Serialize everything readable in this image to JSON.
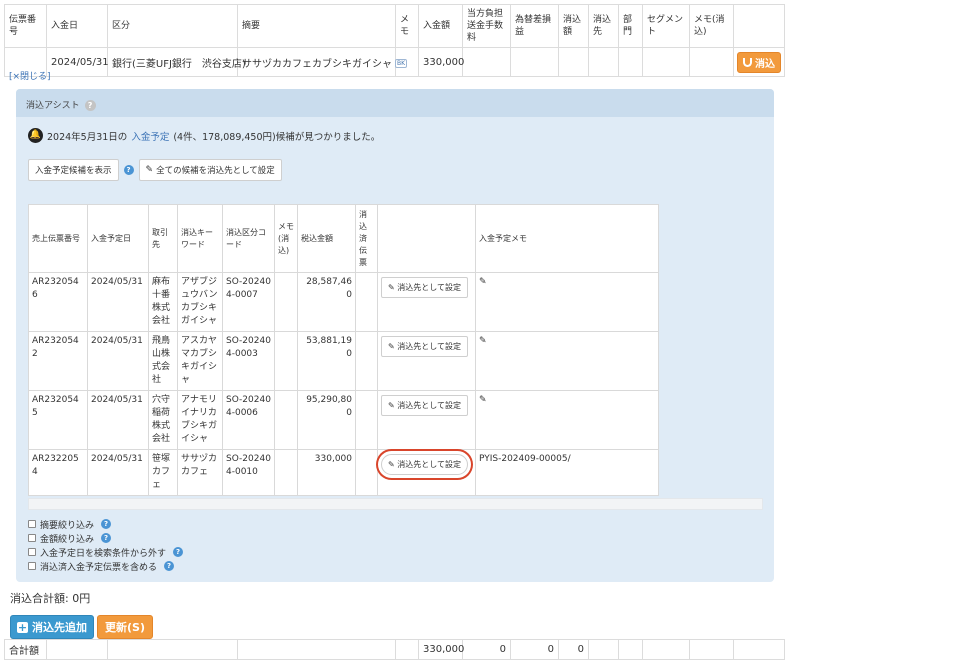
{
  "top_table": {
    "headers": [
      "伝票番号",
      "入金日",
      "区分",
      "摘要",
      "メモ",
      "入金額",
      "当方負担 送金手数料",
      "為替差損益",
      "消込額",
      "消込先",
      "部門",
      "セグメント",
      "メモ(消込)",
      ""
    ],
    "row": {
      "slip_no": "",
      "date": "2024/05/31",
      "category": "銀行(三菱UFJ銀行　渋谷支店)",
      "summary": "ササヅカカフェカブシキガイシャ",
      "bk_badge": "BK",
      "memo": "",
      "amount": "330,000",
      "reconcile_button": "消込"
    }
  },
  "close_link": "[×閉じる]",
  "assist": {
    "title": "消込アシスト",
    "notice_prefix": "2024年5月31日の",
    "notice_link": "入金予定",
    "notice_suffix": "(4件、178,089,450円)候補が見つかりました。",
    "show_candidates_button": "入金予定候補を表示",
    "set_all_button": "全ての候補を消込先として設定",
    "table": {
      "headers": [
        "売上伝票番号",
        "入金予定日",
        "取引先",
        "消込キーワード",
        "消込区分コード",
        "メモ(消込)",
        "税込金額",
        "消込済伝票",
        "",
        "入金予定メモ"
      ],
      "rows": [
        {
          "no": "AR2320546",
          "date": "2024/05/31",
          "partner": "麻布十番株式会社",
          "keyword": "アザブジュウバンカブシキガイシャ",
          "code": "SO-202404-0007",
          "memo": "",
          "amount": "28,587,460",
          "done": "",
          "button": "消込先として設定",
          "note": ""
        },
        {
          "no": "AR2320542",
          "date": "2024/05/31",
          "partner": "飛鳥山株式会社",
          "keyword": "アスカヤマカブシキガイシャ",
          "code": "SO-202404-0003",
          "memo": "",
          "amount": "53,881,190",
          "done": "",
          "button": "消込先として設定",
          "note": ""
        },
        {
          "no": "AR2320545",
          "date": "2024/05/31",
          "partner": "穴守稲荷株式会社",
          "keyword": "アナモリイナリカブシキガイシャ",
          "code": "SO-202404-0006",
          "memo": "",
          "amount": "95,290,800",
          "done": "",
          "button": "消込先として設定",
          "note": ""
        },
        {
          "no": "AR2322054",
          "date": "2024/05/31",
          "partner": "笹塚カフェ",
          "keyword": "ササヅカカフェ",
          "code": "SO-202404-0010",
          "memo": "",
          "amount": "330,000",
          "done": "",
          "button": "消込先として設定",
          "note": "PYIS-202409-00005/"
        }
      ]
    },
    "checkboxes": [
      "摘要絞り込み",
      "金額絞り込み",
      "入金予定日を検索条件から外す",
      "消込済入金予定伝票を含める"
    ]
  },
  "total_label": "消込合計額: 0円",
  "add_button": "消込先追加",
  "update_button": "更新(S)",
  "sum_row": {
    "label": "合計額",
    "amount": "330,000",
    "fee": "0",
    "fx": "0",
    "reconciled": "0"
  },
  "colors": {
    "accent_orange": "#f29a3c",
    "accent_blue": "#3b99cf",
    "panel_bg": "#dfebf6",
    "highlight_circle": "#d9452b"
  },
  "icons": [
    "magnet-icon",
    "bell-icon",
    "help-icon",
    "pencil-icon",
    "edit-icon",
    "plus-icon"
  ]
}
